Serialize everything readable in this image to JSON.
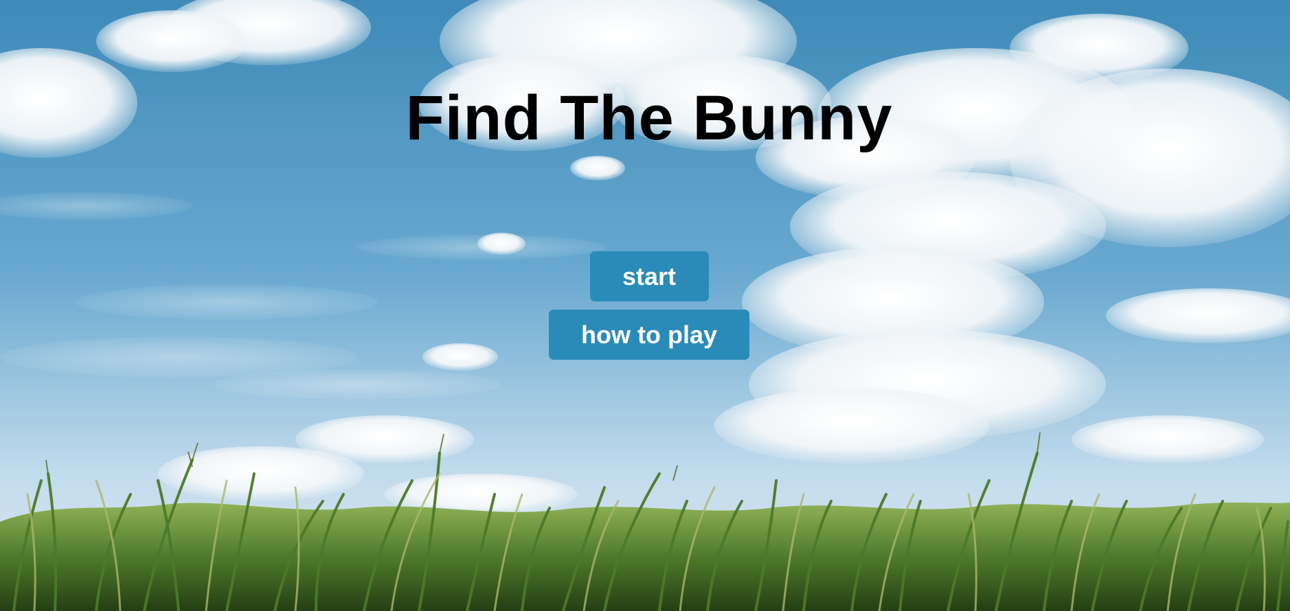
{
  "game": {
    "title": "Find The Bunny",
    "menu": {
      "start_label": "start",
      "how_to_play_label": "how to play"
    }
  },
  "colors": {
    "button_bg": "#2a8bb8",
    "button_text": "#ffffff",
    "title_text": "#000000",
    "sky_top": "#3f8fbd",
    "sky_bottom": "#bcd8ea",
    "grass_dark": "#2f5a1e",
    "grass_light": "#7ea84a"
  },
  "background": {
    "scene": "sky-with-clouds-over-cornfield"
  }
}
